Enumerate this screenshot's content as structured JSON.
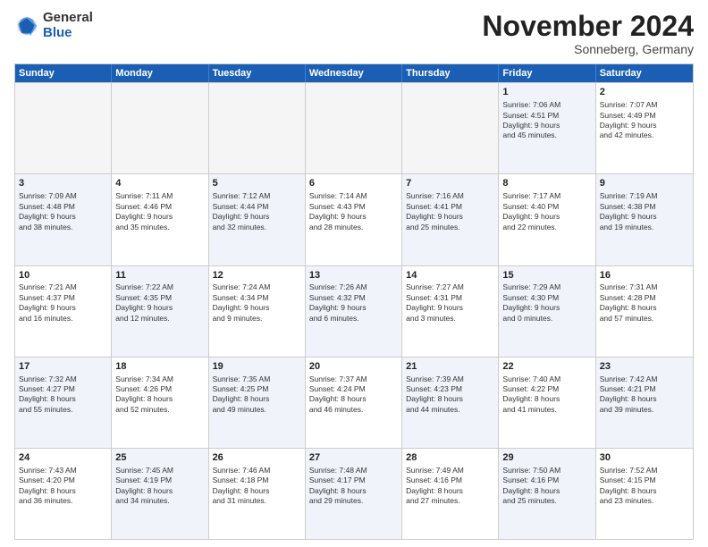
{
  "logo": {
    "general": "General",
    "blue": "Blue"
  },
  "header": {
    "month": "November 2024",
    "location": "Sonneberg, Germany"
  },
  "days": [
    "Sunday",
    "Monday",
    "Tuesday",
    "Wednesday",
    "Thursday",
    "Friday",
    "Saturday"
  ],
  "weeks": [
    [
      {
        "day": "",
        "info": ""
      },
      {
        "day": "",
        "info": ""
      },
      {
        "day": "",
        "info": ""
      },
      {
        "day": "",
        "info": ""
      },
      {
        "day": "",
        "info": ""
      },
      {
        "day": "1",
        "info": "Sunrise: 7:06 AM\nSunset: 4:51 PM\nDaylight: 9 hours\nand 45 minutes."
      },
      {
        "day": "2",
        "info": "Sunrise: 7:07 AM\nSunset: 4:49 PM\nDaylight: 9 hours\nand 42 minutes."
      }
    ],
    [
      {
        "day": "3",
        "info": "Sunrise: 7:09 AM\nSunset: 4:48 PM\nDaylight: 9 hours\nand 38 minutes."
      },
      {
        "day": "4",
        "info": "Sunrise: 7:11 AM\nSunset: 4:46 PM\nDaylight: 9 hours\nand 35 minutes."
      },
      {
        "day": "5",
        "info": "Sunrise: 7:12 AM\nSunset: 4:44 PM\nDaylight: 9 hours\nand 32 minutes."
      },
      {
        "day": "6",
        "info": "Sunrise: 7:14 AM\nSunset: 4:43 PM\nDaylight: 9 hours\nand 28 minutes."
      },
      {
        "day": "7",
        "info": "Sunrise: 7:16 AM\nSunset: 4:41 PM\nDaylight: 9 hours\nand 25 minutes."
      },
      {
        "day": "8",
        "info": "Sunrise: 7:17 AM\nSunset: 4:40 PM\nDaylight: 9 hours\nand 22 minutes."
      },
      {
        "day": "9",
        "info": "Sunrise: 7:19 AM\nSunset: 4:38 PM\nDaylight: 9 hours\nand 19 minutes."
      }
    ],
    [
      {
        "day": "10",
        "info": "Sunrise: 7:21 AM\nSunset: 4:37 PM\nDaylight: 9 hours\nand 16 minutes."
      },
      {
        "day": "11",
        "info": "Sunrise: 7:22 AM\nSunset: 4:35 PM\nDaylight: 9 hours\nand 12 minutes."
      },
      {
        "day": "12",
        "info": "Sunrise: 7:24 AM\nSunset: 4:34 PM\nDaylight: 9 hours\nand 9 minutes."
      },
      {
        "day": "13",
        "info": "Sunrise: 7:26 AM\nSunset: 4:32 PM\nDaylight: 9 hours\nand 6 minutes."
      },
      {
        "day": "14",
        "info": "Sunrise: 7:27 AM\nSunset: 4:31 PM\nDaylight: 9 hours\nand 3 minutes."
      },
      {
        "day": "15",
        "info": "Sunrise: 7:29 AM\nSunset: 4:30 PM\nDaylight: 9 hours\nand 0 minutes."
      },
      {
        "day": "16",
        "info": "Sunrise: 7:31 AM\nSunset: 4:28 PM\nDaylight: 8 hours\nand 57 minutes."
      }
    ],
    [
      {
        "day": "17",
        "info": "Sunrise: 7:32 AM\nSunset: 4:27 PM\nDaylight: 8 hours\nand 55 minutes."
      },
      {
        "day": "18",
        "info": "Sunrise: 7:34 AM\nSunset: 4:26 PM\nDaylight: 8 hours\nand 52 minutes."
      },
      {
        "day": "19",
        "info": "Sunrise: 7:35 AM\nSunset: 4:25 PM\nDaylight: 8 hours\nand 49 minutes."
      },
      {
        "day": "20",
        "info": "Sunrise: 7:37 AM\nSunset: 4:24 PM\nDaylight: 8 hours\nand 46 minutes."
      },
      {
        "day": "21",
        "info": "Sunrise: 7:39 AM\nSunset: 4:23 PM\nDaylight: 8 hours\nand 44 minutes."
      },
      {
        "day": "22",
        "info": "Sunrise: 7:40 AM\nSunset: 4:22 PM\nDaylight: 8 hours\nand 41 minutes."
      },
      {
        "day": "23",
        "info": "Sunrise: 7:42 AM\nSunset: 4:21 PM\nDaylight: 8 hours\nand 39 minutes."
      }
    ],
    [
      {
        "day": "24",
        "info": "Sunrise: 7:43 AM\nSunset: 4:20 PM\nDaylight: 8 hours\nand 36 minutes."
      },
      {
        "day": "25",
        "info": "Sunrise: 7:45 AM\nSunset: 4:19 PM\nDaylight: 8 hours\nand 34 minutes."
      },
      {
        "day": "26",
        "info": "Sunrise: 7:46 AM\nSunset: 4:18 PM\nDaylight: 8 hours\nand 31 minutes."
      },
      {
        "day": "27",
        "info": "Sunrise: 7:48 AM\nSunset: 4:17 PM\nDaylight: 8 hours\nand 29 minutes."
      },
      {
        "day": "28",
        "info": "Sunrise: 7:49 AM\nSunset: 4:16 PM\nDaylight: 8 hours\nand 27 minutes."
      },
      {
        "day": "29",
        "info": "Sunrise: 7:50 AM\nSunset: 4:16 PM\nDaylight: 8 hours\nand 25 minutes."
      },
      {
        "day": "30",
        "info": "Sunrise: 7:52 AM\nSunset: 4:15 PM\nDaylight: 8 hours\nand 23 minutes."
      }
    ]
  ]
}
